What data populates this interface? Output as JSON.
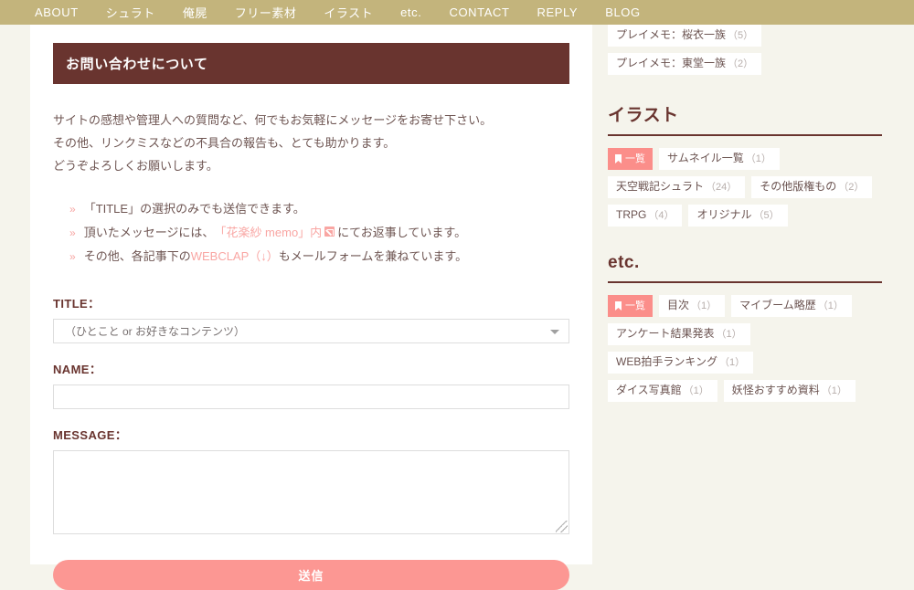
{
  "nav": {
    "items": [
      {
        "label": "ABOUT",
        "name": "nav-item-about"
      },
      {
        "label": "シュラト",
        "name": "nav-item-shurato"
      },
      {
        "label": "俺屍",
        "name": "nav-item-oreshika"
      },
      {
        "label": "フリー素材",
        "name": "nav-item-free-material"
      },
      {
        "label": "イラスト",
        "name": "nav-item-illust"
      },
      {
        "label": "etc.",
        "name": "nav-item-etc"
      },
      {
        "label": "CONTACT",
        "name": "nav-item-contact"
      },
      {
        "label": "REPLY",
        "name": "nav-item-reply"
      },
      {
        "label": "BLOG",
        "name": "nav-item-blog"
      }
    ]
  },
  "main": {
    "heading": "お問い合わせについて",
    "intro_lines": [
      "サイトの感想や管理人への質問など、何でもお気軽にメッセージをお寄せ下さい。",
      "その他、リンクミスなどの不具合の報告も、とても助かります。",
      "どうぞよろしくお願いします。"
    ],
    "notes": [
      {
        "bullet": "»",
        "parts": [
          {
            "text": "「TITLE」の選択のみでも送信できます。",
            "style": "plain"
          }
        ]
      },
      {
        "bullet": "»",
        "parts": [
          {
            "text": "頂いたメッセージには、",
            "style": "plain"
          },
          {
            "text": "「花楽紗 memo」内",
            "style": "link"
          },
          {
            "text": "external-link-icon",
            "style": "icon"
          },
          {
            "text": "にてお返事しています。",
            "style": "plain"
          }
        ]
      },
      {
        "bullet": "»",
        "parts": [
          {
            "text": "その他、各記事下の",
            "style": "plain"
          },
          {
            "text": "WEBCLAP（↓）",
            "style": "link"
          },
          {
            "text": "もメールフォームを兼ねています。",
            "style": "plain"
          }
        ]
      }
    ],
    "form": {
      "title_label": "TITLE：",
      "title_value": "（ひとこと or お好きなコンテンツ）",
      "name_label": "NAME：",
      "name_value": "",
      "name_placeholder": "",
      "message_label": "MESSAGE：",
      "message_value": "",
      "message_placeholder": "",
      "submit_label": "送信"
    }
  },
  "sidebar": {
    "top_tags": [
      {
        "label": "プレイメモ：桜衣一族",
        "count": "（5）"
      },
      {
        "label": "プレイメモ：東堂一族",
        "count": "（2）"
      }
    ],
    "sections": [
      {
        "heading": "イラスト",
        "all_label": "一覧",
        "tags": [
          {
            "label": "サムネイル一覧",
            "count": "（1）"
          },
          {
            "label": "天空戦記シュラト",
            "count": "（24）"
          },
          {
            "label": "その他版権もの",
            "count": "（2）"
          },
          {
            "label": "TRPG",
            "count": "（4）"
          },
          {
            "label": "オリジナル",
            "count": "（5）"
          }
        ]
      },
      {
        "heading": "etc.",
        "all_label": "一覧",
        "tags": [
          {
            "label": "目次",
            "count": "（1）"
          },
          {
            "label": "マイブーム略歴",
            "count": "（1）"
          },
          {
            "label": "アンケート結果発表",
            "count": "（1）"
          },
          {
            "label": "WEB拍手ランキング",
            "count": "（1）"
          },
          {
            "label": "ダイス写真館",
            "count": "（1）"
          },
          {
            "label": "妖怪おすすめ資料",
            "count": "（1）"
          }
        ]
      }
    ]
  },
  "colors": {
    "nav_bg": "#c3b47c",
    "page_bg": "#f5f4ec",
    "heading_bar": "#69342f",
    "accent_pink": "#fc9793",
    "badge_pink": "#fb8e8a",
    "panel": "#ffffff"
  }
}
